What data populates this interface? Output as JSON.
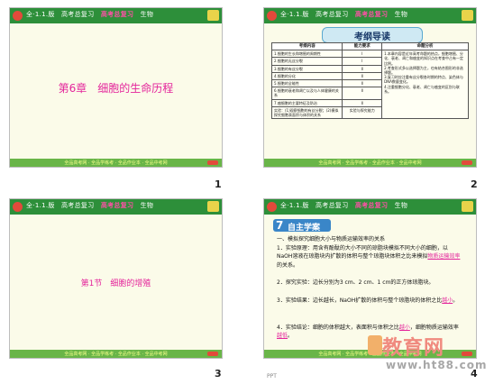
{
  "header": {
    "prefix": "全·1.1.版",
    "course": "高考总复习",
    "brand": "高考总复习",
    "subject": "生物"
  },
  "footer": "全品高考网 · 全品学练考 · 全品作业本 · 全品中考网",
  "slides": [
    {
      "num": "1",
      "title": "第6章　细胞的生命历程"
    },
    {
      "num": "2",
      "banner": "考纲导读",
      "table": {
        "headers": [
          "考纲内容",
          "能力要求",
          "命题分析"
        ],
        "rows": [
          [
            "1.细胞的生长和增殖的周期性",
            "Ⅰ",
            "1.本章内容是近年高考命题的热点，细胞增殖、分化、衰老、凋亡和癌变的知识点在考查中占有一定比例。"
          ],
          [
            "2.细胞的无丝分裂",
            "Ⅰ",
            "2.考查形式多以选择题为主，也有结合图形的非选择题。"
          ],
          [
            "3.细胞的有丝分裂",
            "Ⅱ",
            "3.复习时应注重有丝分裂各时期的特点、染色体与DNA数量变化。"
          ],
          [
            "4.细胞的分化",
            "Ⅱ",
            "4.注重细胞分化、衰老、凋亡与癌变的区别与联系。"
          ],
          [
            "5.细胞的全能性",
            "Ⅱ",
            ""
          ],
          [
            "6.细胞的衰老和凋亡以及与人体健康的关系",
            "Ⅱ",
            ""
          ],
          [
            "7.癌细胞的主要特征及防治",
            "Ⅱ",
            ""
          ],
          [
            "实验：(1)观察细胞的有丝分裂；(2)模拟探究细胞表面积与体积的关系",
            "实验与探究能力",
            ""
          ]
        ]
      }
    },
    {
      "num": "3",
      "title": "第1节　细胞的增殖"
    },
    {
      "num": "4",
      "banner_num": "7",
      "banner": "自主学案",
      "heading": "一、模拟探究细胞大小与物质运输效率的关系",
      "p1": "1．实验原理：用含有酚酞的大小不同的琼脂块模拟不同大小的细胞，以NaOH溶液在琼脂块内扩散的体积与整个琼脂块体积之比来模拟",
      "p1_ans": "物质运输效率",
      "p1_end": "的关系。",
      "p2": "2．探究实验：边长分别为3 cm、2 cm、1 cm的正方体琼脂块。",
      "p3": "3．实验结果：边长越长，NaOH扩散的体积与整个琼脂块的体积之比",
      "p3_ans": "越小",
      "p3_end": "。",
      "p4": "4．实验结论：细胞的体积越大，表面积与体积之比",
      "p4_ans": "越小",
      "p4_mid": "，细胞物质运输效率",
      "p4_ans2": "越低",
      "p4_end": "。"
    }
  ],
  "watermark": {
    "big": "教育网",
    "url": "www.ht88.com"
  },
  "corner_note": "PPT"
}
